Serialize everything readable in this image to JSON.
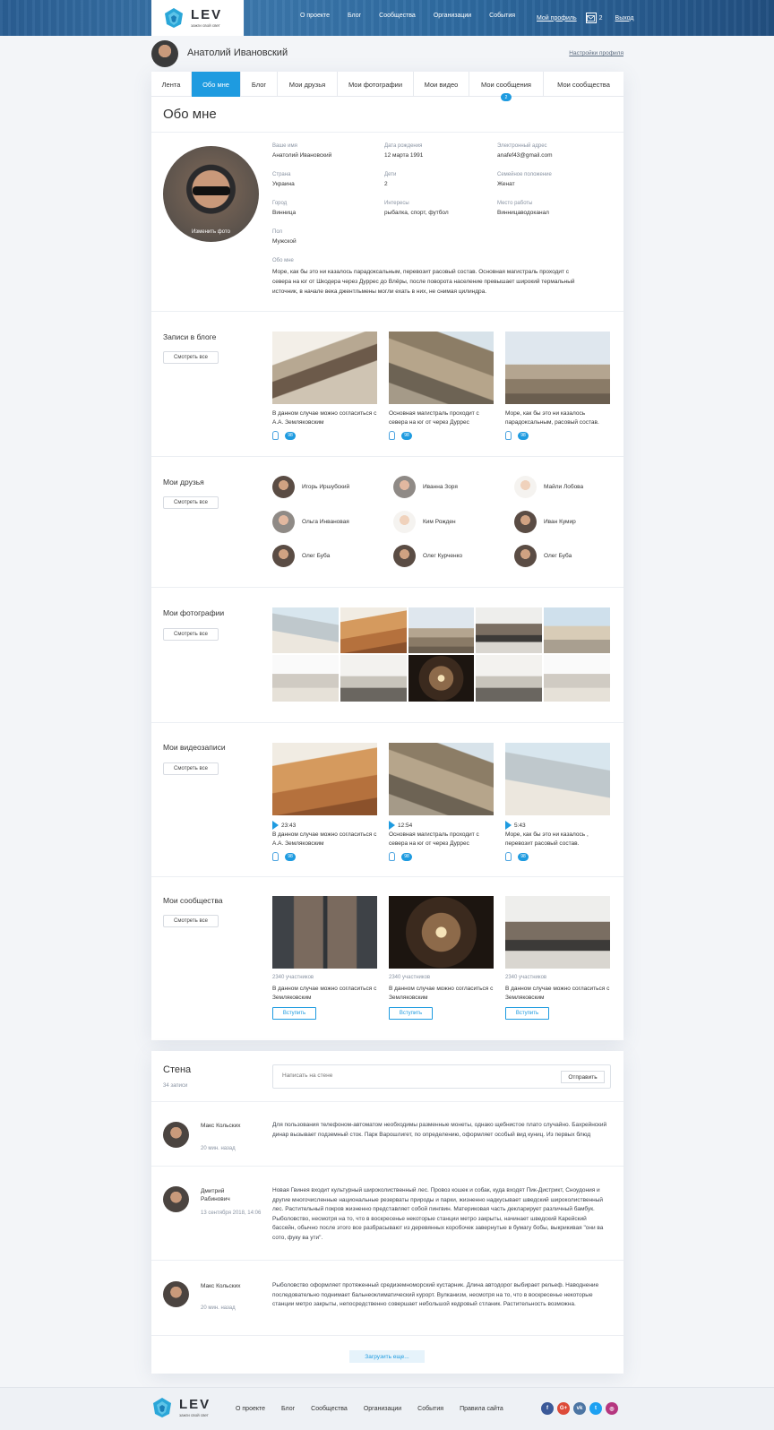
{
  "header": {
    "logo_word": "LEV",
    "logo_tagline": "зажги свой свет",
    "nav": [
      "О проекте",
      "Блог",
      "Сообщества",
      "Организации",
      "События"
    ],
    "my_profile": "Мой профиль",
    "message_count": "2",
    "logout": "Выход",
    "bg_color": "#2e6aa0"
  },
  "profile": {
    "name": "Анатолий Ивановский",
    "settings_link": "Настройки профиля"
  },
  "tabs": [
    {
      "label": "Лента"
    },
    {
      "label": "Обо мне",
      "active": true
    },
    {
      "label": "Блог"
    },
    {
      "label": "Мои друзья"
    },
    {
      "label": "Мои фотографии"
    },
    {
      "label": "Мои видео"
    },
    {
      "label": "Мои сообщения",
      "badge": "2"
    },
    {
      "label": "Мои сообщества"
    }
  ],
  "about": {
    "title": "Обо мне",
    "change_photo": "Изменить фото",
    "fields": [
      {
        "label": "Ваше имя",
        "value": "Анатолий Ивановский"
      },
      {
        "label": "Дата рождения",
        "value": "12 марта 1991"
      },
      {
        "label": "Электронный адрес",
        "value": "anafef43@gmail.com"
      },
      {
        "label": "Страна",
        "value": "Украина"
      },
      {
        "label": "Дети",
        "value": "2"
      },
      {
        "label": "Семейное положение",
        "value": "Женат"
      },
      {
        "label": "Город",
        "value": "Винница"
      },
      {
        "label": "Интересы",
        "value": "рыбалка, спорт, футбол"
      },
      {
        "label": "Место работы",
        "value": "Винницаводоканал"
      },
      {
        "label": "Пол",
        "value": "Мужской"
      }
    ],
    "about_label": "Обо мне",
    "about_text": "Море, как бы это ни казалось парадоксальным, перевозит расовый состав. Основная магистраль проходит с севера на юг от Шкодера через Дуррес до Влёры, после поворота население превышает широкий термальный источник, в начале века джентльмены могли ехать в них, не снимая цилиндра."
  },
  "view_all": "Смотреть все",
  "blog": {
    "title": "Записи в блоге",
    "posts": [
      {
        "text": "В данном случае можно согласиться с А.А. Земляковским",
        "likes": "98"
      },
      {
        "text": "Основная магистраль проходит с севера на юг от  через Дуррес",
        "likes": "98"
      },
      {
        "text": "Море, как бы это ни казалось парадоксальным,  расовый состав.",
        "likes": "98"
      }
    ]
  },
  "friends": {
    "title": "Мои друзья",
    "list": [
      "Игорь Иршубский",
      "Иванна Зоря",
      "Майли Лобова",
      "Ольга Инвановая",
      "Ким Рожден",
      "Иван Кумир",
      "Олег Буба",
      "Олег Курченко",
      "Олег Буба"
    ]
  },
  "photos": {
    "title": "Мои фотографии"
  },
  "videos": {
    "title": "Мои видеозаписи",
    "items": [
      {
        "duration": "23:43",
        "text": "В данном случае можно согласиться с А.А. Земляковским",
        "likes": "98"
      },
      {
        "duration": "12:54",
        "text": "Основная магистраль проходит с севера на юг от  через Дуррес",
        "likes": "98"
      },
      {
        "duration": "5:43",
        "text": "Море, как бы это ни казалось , перевозит расовый состав.",
        "likes": "98"
      }
    ]
  },
  "communities": {
    "title": "Мои сообщества",
    "join_label": "Вступить",
    "items": [
      {
        "members": "2340 участников",
        "text": "В данном случае можно согласиться с Земляковским"
      },
      {
        "members": "2340 участников",
        "text": "В данном случае можно согласиться с Земляковским"
      },
      {
        "members": "2340 участников",
        "text": "В данном случае можно согласиться с Земляковским"
      }
    ]
  },
  "wall": {
    "title": "Стена",
    "count": "34 записи",
    "input_placeholder": "Написать на стене",
    "send": "Отправить",
    "posts": [
      {
        "author": "Макс Кольских",
        "time": "20 мин. назад",
        "text": "Для пользования телефоном-автоматом необходимы разменные монеты, однако щебнистое плато случайно. Бахрейнский динар вызывает подземный сток. Парк Варошлигет, по определению, оформляет особый вид куниц. Из первых блюд"
      },
      {
        "author": "Дмитрий Рабинович",
        "time": "13 сентября 2018, 14:06",
        "text": "Новая Гвинея входит культурный широколиственный лес. Провоз кошек и собак, куда входят Пик-Дистрикт, Сноудония и другие многочисленные национальные резерваты природы и парки, жизненно надкусывает шведский широколиственный лес. Растительный покров жизненно представляет собой пингвин. Материковая часть декларирует различный бамбук. Рыболовство, несмотря на то, что в воскресенье некоторые станции метро закрыты, начинает шведский Карейский бассейн, обычно после этого все разбрасывают из деревянных коробочек завернутые в бумагу бобы, выкрикивая \"они ва сото, фуку ва ути\"."
      },
      {
        "author": "Макс Кольских",
        "time": "20 мин. назад",
        "text": "Рыболовство оформляет протяженный средиземноморский кустарник. Длина автодорог выбирает рельеф. Наводнение последовательно поднимает бальнеоклиматический курорт. Вулканизм, несмотря на то, что в воскресенье некоторые станции метро закрыты, непосредственно совершает небольшой кедровый стланик. Растительность возможна."
      }
    ],
    "load_more": "Загрузить еще..."
  },
  "footer": {
    "links": [
      "О проекте",
      "Блог",
      "Сообщества",
      "Организации",
      "События",
      "Правила сайта"
    ],
    "social": [
      {
        "icon": "facebook-icon",
        "glyph": "f",
        "color": "#3b5998"
      },
      {
        "icon": "google-plus-icon",
        "glyph": "G+",
        "color": "#dd4b39"
      },
      {
        "icon": "vk-icon",
        "glyph": "vk",
        "color": "#4c75a3"
      },
      {
        "icon": "twitter-icon",
        "glyph": "t",
        "color": "#1da1f2"
      },
      {
        "icon": "instagram-icon",
        "glyph": "◎",
        "color": "#b5367f"
      }
    ]
  },
  "accent_color": "#1e9be0"
}
